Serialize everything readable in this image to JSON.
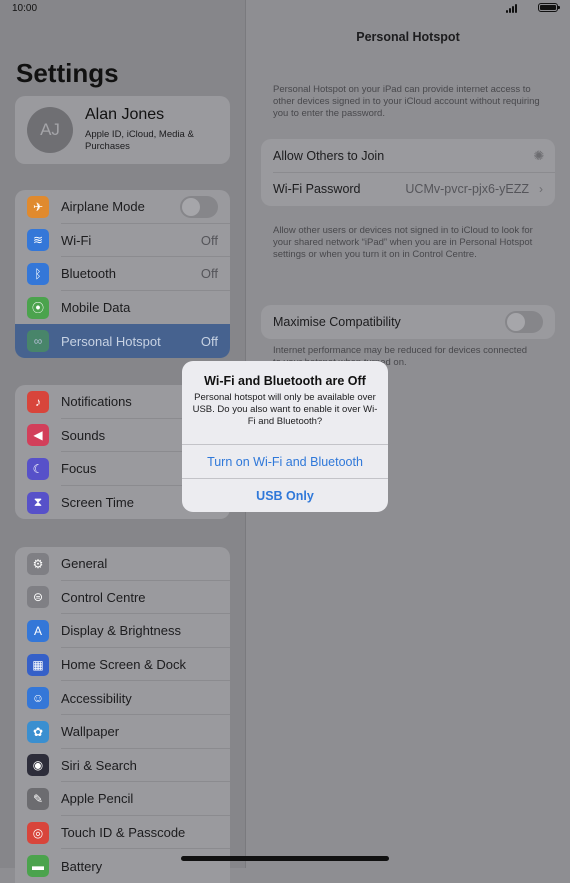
{
  "status": {
    "time": "10:00"
  },
  "settings_title": "Settings",
  "profile": {
    "initials": "AJ",
    "name": "Alan Jones",
    "subtitle": "Apple ID, iCloud, Media & Purchases"
  },
  "group1": [
    {
      "label": "Airplane Mode",
      "icon": "airplane-icon",
      "color": "#e08a2e",
      "toggle": true
    },
    {
      "label": "Wi-Fi",
      "value": "Off",
      "icon": "wifi-icon",
      "color": "#3477d8"
    },
    {
      "label": "Bluetooth",
      "value": "Off",
      "icon": "bluetooth-icon",
      "color": "#3477d8"
    },
    {
      "label": "Mobile Data",
      "icon": "antenna-icon",
      "color": "#4ba34d"
    },
    {
      "label": "Personal Hotspot",
      "value": "Off",
      "icon": "hotspot-icon",
      "color": "#4ba34d",
      "selected": true
    }
  ],
  "group2": [
    {
      "label": "Notifications",
      "icon": "bell-icon",
      "color": "#d8453b"
    },
    {
      "label": "Sounds",
      "icon": "speaker-icon",
      "color": "#d23f5a"
    },
    {
      "label": "Focus",
      "icon": "moon-icon",
      "color": "#5751c9"
    },
    {
      "label": "Screen Time",
      "icon": "hourglass-icon",
      "color": "#5751c9"
    }
  ],
  "group3": [
    {
      "label": "General",
      "icon": "gear-icon",
      "color": "#7f7f84"
    },
    {
      "label": "Control Centre",
      "icon": "switches-icon",
      "color": "#7f7f84"
    },
    {
      "label": "Display & Brightness",
      "icon": "display-icon",
      "color": "#3477d8"
    },
    {
      "label": "Home Screen & Dock",
      "icon": "grid-icon",
      "color": "#3560c8"
    },
    {
      "label": "Accessibility",
      "icon": "accessibility-icon",
      "color": "#3477d8"
    },
    {
      "label": "Wallpaper",
      "icon": "flower-icon",
      "color": "#3a8fd0"
    },
    {
      "label": "Siri & Search",
      "icon": "siri-icon",
      "color": "#2d2d3a"
    },
    {
      "label": "Apple Pencil",
      "icon": "pencil-icon",
      "color": "#6c6c70"
    },
    {
      "label": "Touch ID & Passcode",
      "icon": "fingerprint-icon",
      "color": "#d8453b"
    },
    {
      "label": "Battery",
      "icon": "battery-icon",
      "color": "#4ba34d"
    }
  ],
  "detail": {
    "nav_title": "Personal Hotspot",
    "intro": "Personal Hotspot on your iPad can provide internet access to other devices signed in to your iCloud account without requiring you to enter the password.",
    "allow_label": "Allow Others to Join",
    "wifi_password_label": "Wi-Fi Password",
    "wifi_password_value": "UCMv-pvcr-pjx6-yEZZ",
    "share_note": "Allow other users or devices not signed in to iCloud to look for your shared network “iPad” when you are in Personal Hotspot settings or when you turn it on in Control Centre.",
    "maximise_label": "Maximise Compatibility",
    "maximise_note": "Internet performance may be reduced for devices connected to your hotspot when turned on."
  },
  "alert": {
    "title": "Wi-Fi and Bluetooth are Off",
    "message": "Personal hotspot will only be available over USB. Do you also want to enable it over Wi-Fi and Bluetooth?",
    "primary": "Turn on Wi-Fi and Bluetooth",
    "secondary": "USB Only"
  }
}
